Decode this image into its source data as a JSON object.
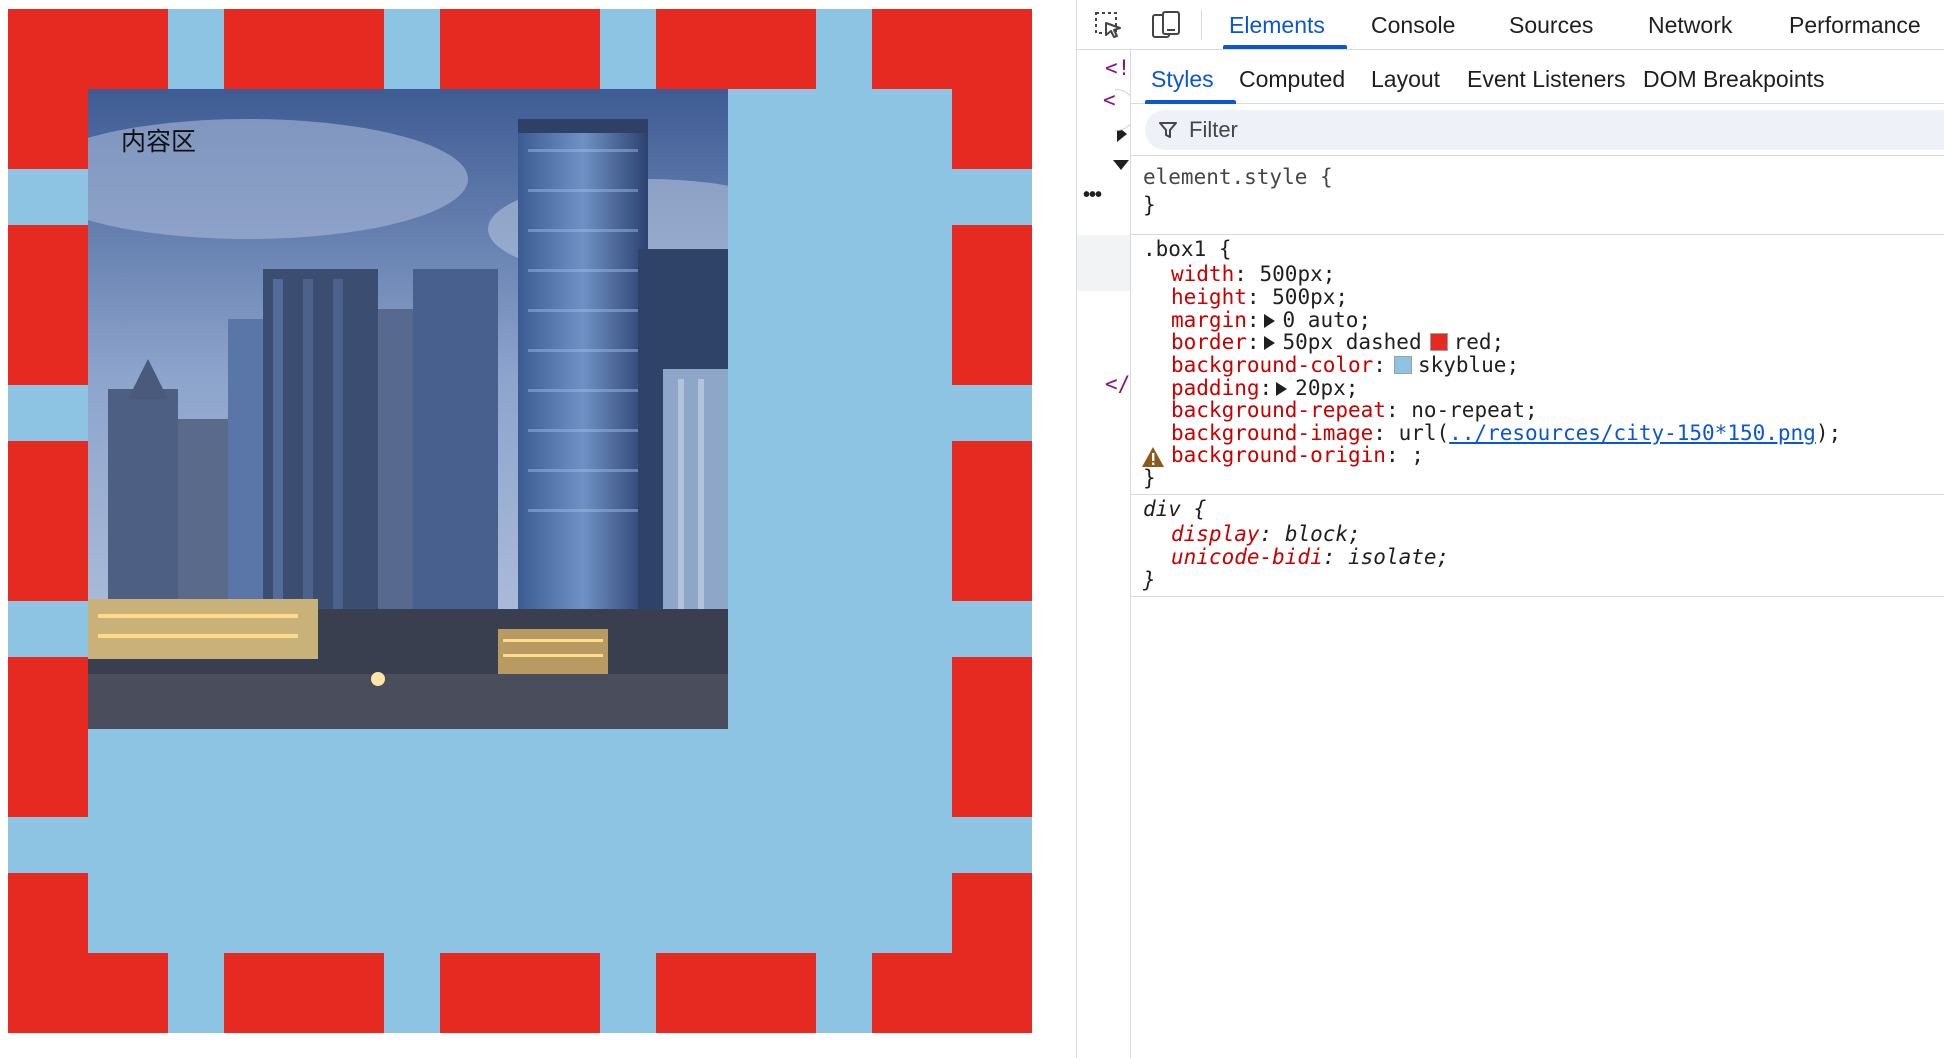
{
  "page": {
    "content_label": "内容区",
    "box_border_color": "#e62a22",
    "box_background_color": "#8dc3e3"
  },
  "devtools": {
    "toolbar_icons": [
      "inspect-element-icon",
      "device-toggle-icon"
    ],
    "tabs": [
      {
        "label": "Elements",
        "active": true
      },
      {
        "label": "Console"
      },
      {
        "label": "Sources"
      },
      {
        "label": "Network"
      },
      {
        "label": "Performance"
      }
    ],
    "dom_fragments": [
      "<!",
      "<h",
      "</"
    ],
    "dom_ellipsis": "•••",
    "sub_tabs": [
      {
        "label": "Styles",
        "active": true
      },
      {
        "label": "Computed"
      },
      {
        "label": "Layout"
      },
      {
        "label": "Event Listeners"
      },
      {
        "label": "DOM Breakpoints"
      }
    ],
    "filter": {
      "label": "Filter"
    },
    "rules": {
      "element_style": {
        "selector": "element.style {",
        "close": "}"
      },
      "box1": {
        "selector": ".box1 {",
        "close": "}",
        "props": [
          {
            "name": "width",
            "value": "500px;"
          },
          {
            "name": "height",
            "value": "500px;"
          },
          {
            "name": "margin",
            "value": "0 auto;",
            "expandable": true
          },
          {
            "name": "border",
            "value_before_swatch": "50px dashed",
            "value": "red;",
            "expandable": true,
            "swatch": "#e62a22"
          },
          {
            "name": "background-color",
            "value": "skyblue;",
            "swatch": "#8dc3e3"
          },
          {
            "name": "padding",
            "value": "20px;",
            "expandable": true
          },
          {
            "name": "background-repeat",
            "value": "no-repeat;"
          },
          {
            "name": "background-image",
            "value_prefix": "url(",
            "link": "../resources/city-150*150.png",
            "value_suffix": ");"
          },
          {
            "name": "background-origin",
            "value": ";",
            "warning": true
          }
        ]
      },
      "div": {
        "selector": "div {",
        "close": "}",
        "props": [
          {
            "name": "display",
            "value": "block;"
          },
          {
            "name": "unicode-bidi",
            "value": "isolate;"
          }
        ]
      }
    },
    "accent_color": "#0b57d0"
  }
}
